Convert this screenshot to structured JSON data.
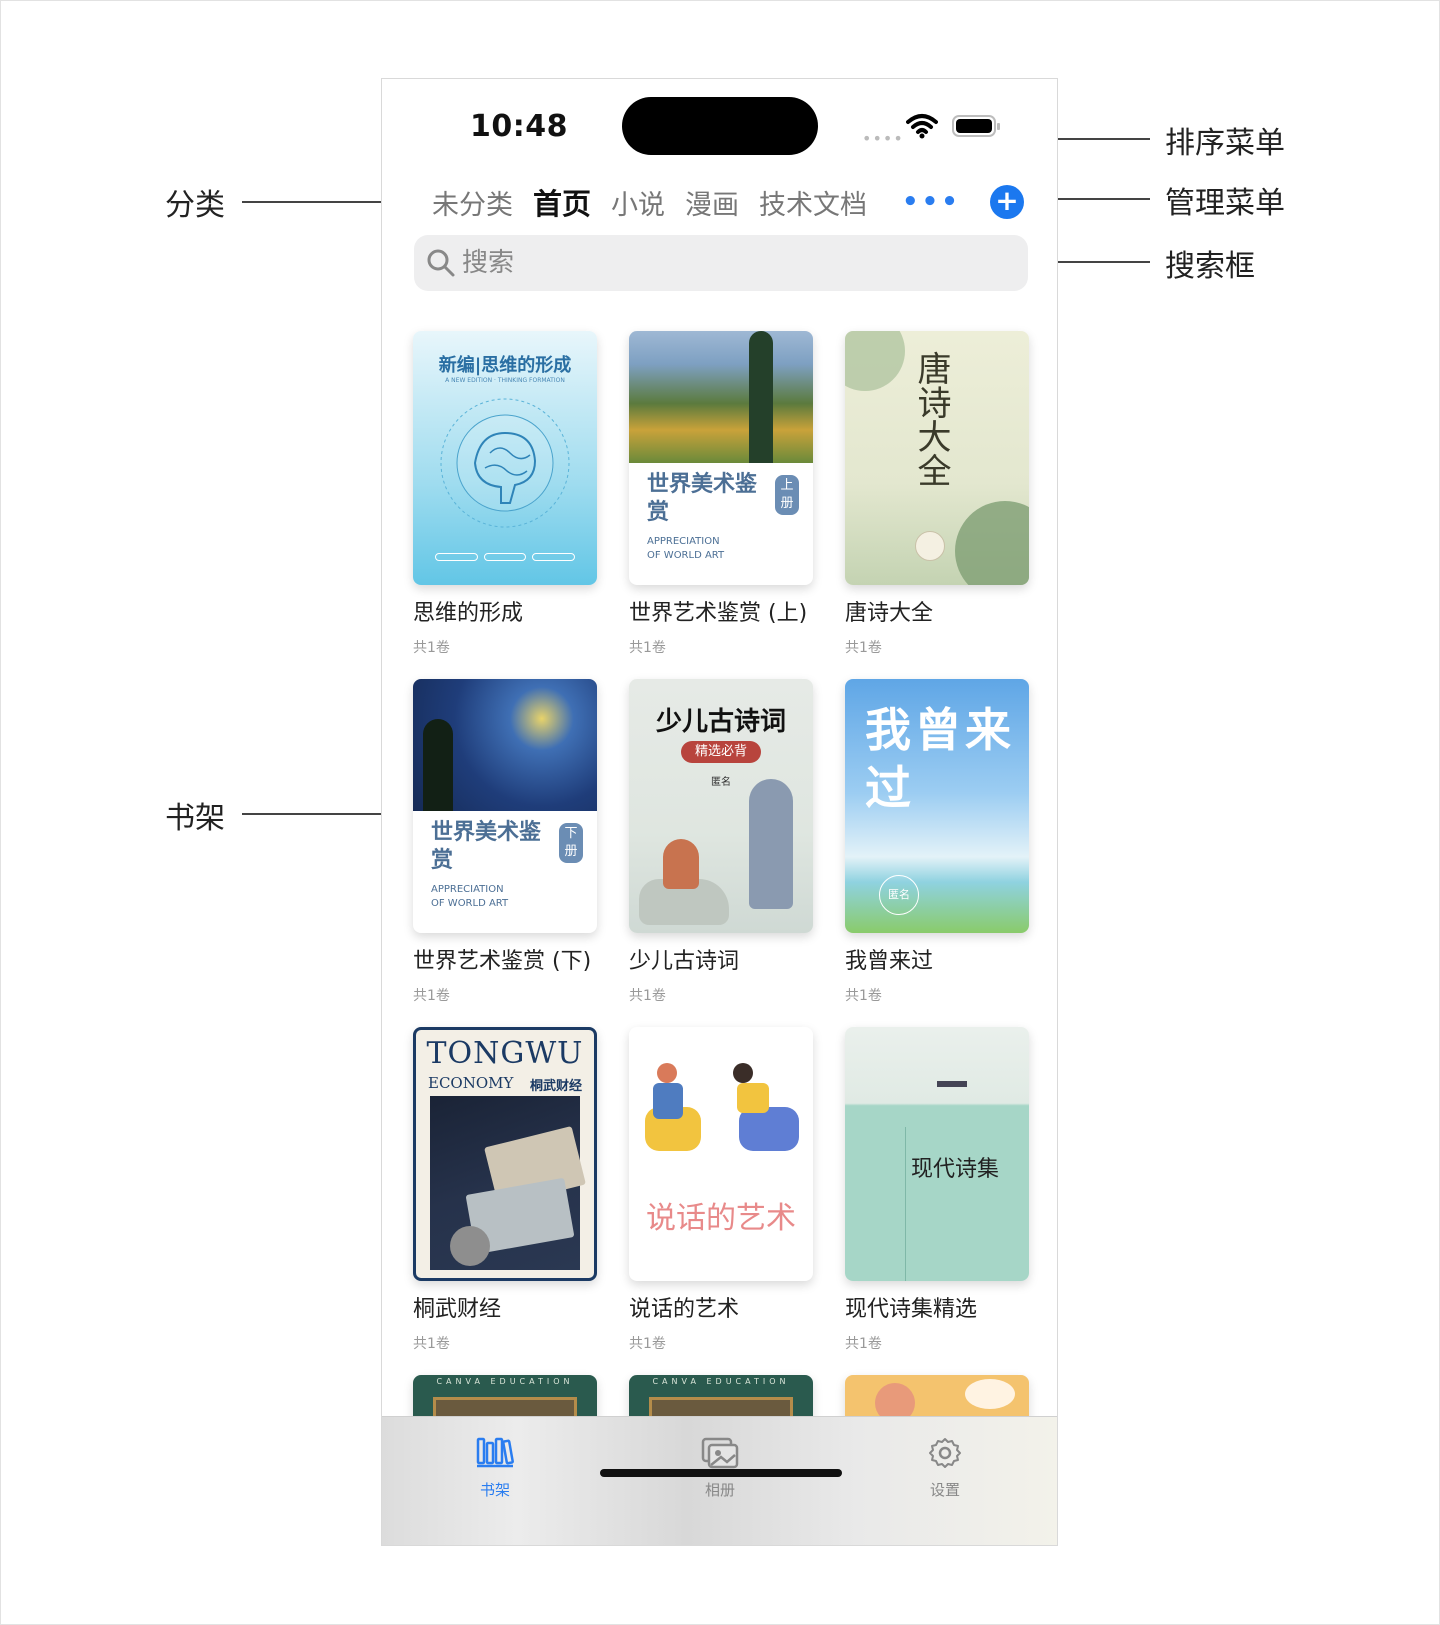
{
  "status": {
    "time": "10:48"
  },
  "categories": [
    "未分类",
    "首页",
    "小说",
    "漫画",
    "技术文档"
  ],
  "active_category": "首页",
  "search": {
    "placeholder": "搜索"
  },
  "books": [
    {
      "title": "思维的形成",
      "volumes": "共1卷",
      "cover_text": "新编|思维的形成",
      "cover_sub": "A NEW EDITION · THINKING FORMATION"
    },
    {
      "title": "世界艺术鉴赏 (上)",
      "volumes": "共1卷",
      "cover_text": "世界美术鉴赏",
      "cover_tag": "上册",
      "cover_sub": "APPRECIATION OF WORLD ART"
    },
    {
      "title": "唐诗大全",
      "volumes": "共1卷",
      "cover_text": "唐诗大全"
    },
    {
      "title": "世界艺术鉴赏 (下)",
      "volumes": "共1卷",
      "cover_text": "世界美术鉴赏",
      "cover_tag": "下册",
      "cover_sub": "APPRECIATION OF WORLD ART"
    },
    {
      "title": "少儿古诗词",
      "volumes": "共1卷",
      "cover_text": "少儿古诗词",
      "cover_sub": "精选必背",
      "cover_author": "匿名"
    },
    {
      "title": "我曾来过",
      "volumes": "共1卷",
      "cover_text": "我曾来过",
      "cover_author": "匿名"
    },
    {
      "title": "桐武财经",
      "volumes": "共1卷",
      "cover_text": "TONGWU",
      "cover_sub": "ECONOMY",
      "cover_tag": "桐武财经"
    },
    {
      "title": "说话的艺术",
      "volumes": "共1卷",
      "cover_text": "说话的艺术"
    },
    {
      "title": "现代诗集精选",
      "volumes": "共1卷",
      "cover_text": "现代诗集"
    }
  ],
  "partial_books": [
    {
      "cover_text": "CANVA EDUCATION"
    },
    {
      "cover_text": "CANVA EDUCATION"
    },
    {
      "cover_text": ""
    }
  ],
  "tab_bar": [
    {
      "label": "书架",
      "icon": "bookshelf-icon",
      "active": true
    },
    {
      "label": "相册",
      "icon": "photos-icon",
      "active": false
    },
    {
      "label": "设置",
      "icon": "gear-icon",
      "active": false
    }
  ],
  "annotations": {
    "sort_menu": "排序菜单",
    "category": "分类",
    "manage_menu": "管理菜单",
    "search_box": "搜索框",
    "bookshelf": "书架"
  },
  "colors": {
    "accent": "#1b78ef"
  }
}
